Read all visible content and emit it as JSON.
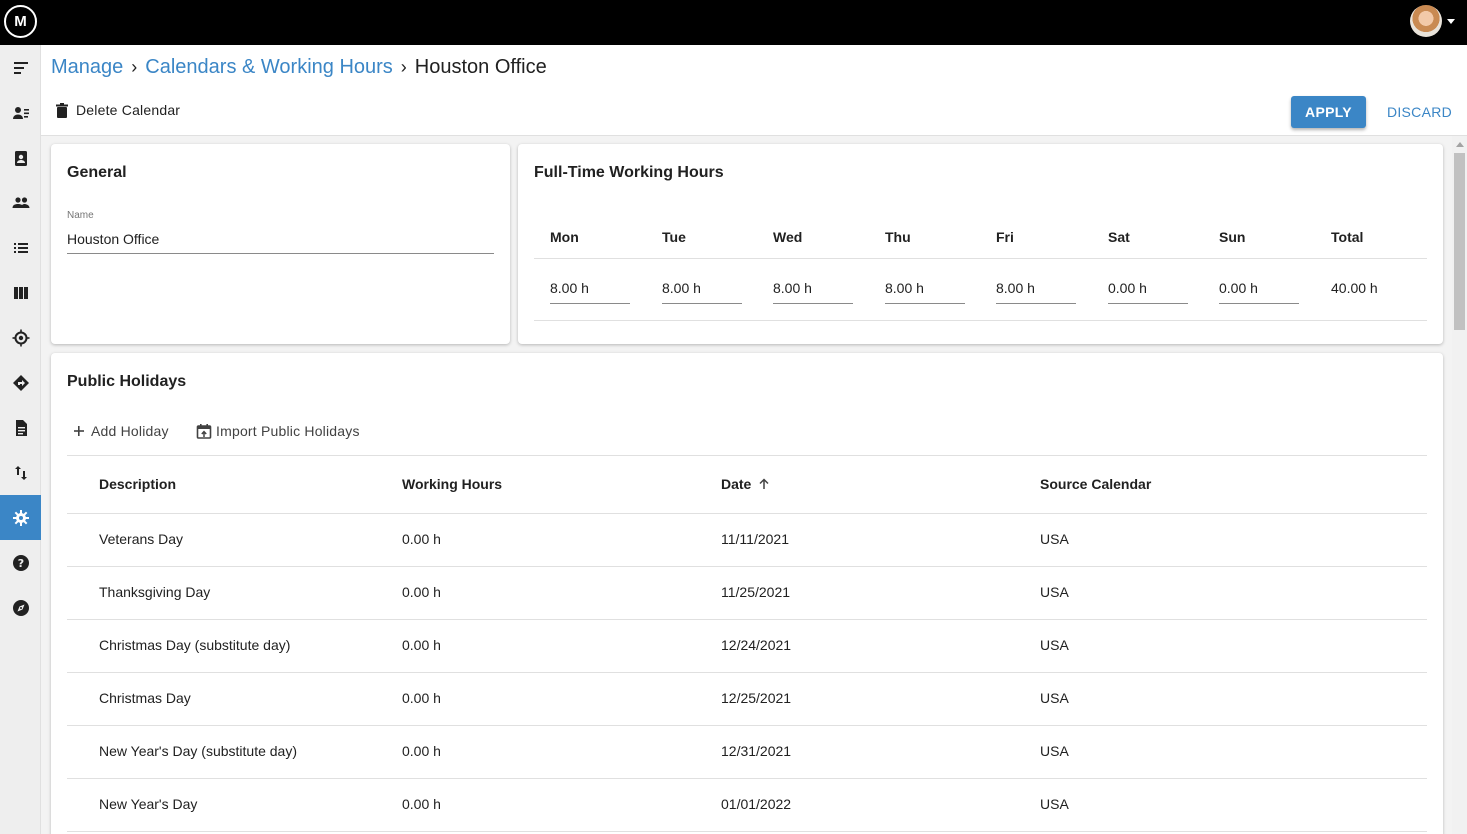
{
  "app": {
    "logo_text": "M"
  },
  "breadcrumb": {
    "items": [
      "Manage",
      "Calendars & Working Hours"
    ],
    "current": "Houston Office",
    "separator": "›"
  },
  "toolbar": {
    "delete_label": "Delete Calendar",
    "apply_label": "APPLY",
    "discard_label": "DISCARD"
  },
  "general": {
    "title": "General",
    "name_label": "Name",
    "name_value": "Houston Office"
  },
  "working_hours": {
    "title": "Full-Time Working Hours",
    "days": [
      {
        "label": "Mon",
        "value": "8.00 h"
      },
      {
        "label": "Tue",
        "value": "8.00 h"
      },
      {
        "label": "Wed",
        "value": "8.00 h"
      },
      {
        "label": "Thu",
        "value": "8.00 h"
      },
      {
        "label": "Fri",
        "value": "8.00 h"
      },
      {
        "label": "Sat",
        "value": "0.00 h"
      },
      {
        "label": "Sun",
        "value": "0.00 h"
      }
    ],
    "total_label": "Total",
    "total_value": "40.00 h"
  },
  "holidays": {
    "title": "Public Holidays",
    "add_label": "Add Holiday",
    "import_label": "Import Public Holidays",
    "columns": [
      "Description",
      "Working Hours",
      "Date",
      "Source Calendar"
    ],
    "rows": [
      [
        "Veterans Day",
        "0.00 h",
        "11/11/2021",
        "USA"
      ],
      [
        "Thanksgiving Day",
        "0.00 h",
        "11/25/2021",
        "USA"
      ],
      [
        "Christmas Day (substitute day)",
        "0.00 h",
        "12/24/2021",
        "USA"
      ],
      [
        "Christmas Day",
        "0.00 h",
        "12/25/2021",
        "USA"
      ],
      [
        "New Year's Day (substitute day)",
        "0.00 h",
        "12/31/2021",
        "USA"
      ],
      [
        "New Year's Day",
        "0.00 h",
        "01/01/2022",
        "USA"
      ]
    ]
  },
  "sidebar": {
    "items": [
      {
        "icon": "menu-icon",
        "active": false
      },
      {
        "icon": "person-list-icon",
        "active": false
      },
      {
        "icon": "clipboard-person-icon",
        "active": false
      },
      {
        "icon": "people-icon",
        "active": false
      },
      {
        "icon": "list-icon",
        "active": false
      },
      {
        "icon": "columns-icon",
        "active": false
      },
      {
        "icon": "target-icon",
        "active": false
      },
      {
        "icon": "directions-icon",
        "active": false
      },
      {
        "icon": "document-icon",
        "active": false
      },
      {
        "icon": "swap-vertical-icon",
        "active": false
      },
      {
        "icon": "gear-icon",
        "active": true
      },
      {
        "icon": "help-icon",
        "active": false
      },
      {
        "icon": "compass-icon",
        "active": false
      }
    ]
  },
  "colors": {
    "accent": "#3b86c6",
    "topbar": "#000000",
    "sidebar": "#eeeeee"
  }
}
